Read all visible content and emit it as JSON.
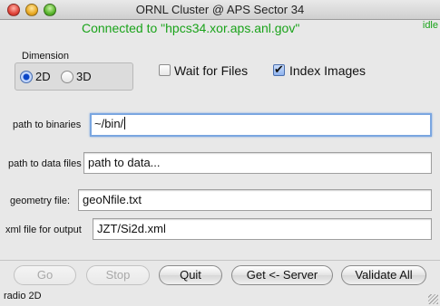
{
  "window": {
    "title": "ORNL Cluster @ APS Sector 34"
  },
  "status": {
    "connection": "Connected to \"hpcs34.xor.aps.anl.gov\"",
    "state": "idle",
    "footer": "radio 2D"
  },
  "dimension": {
    "label": "Dimension",
    "options": [
      "2D",
      "3D"
    ],
    "selected": "2D"
  },
  "options": {
    "wait_for_files": {
      "label": "Wait for Files",
      "checked": false
    },
    "index_images": {
      "label": "Index Images",
      "checked": true
    }
  },
  "fields": {
    "binaries": {
      "label": "path to binaries",
      "value": "~/bin/"
    },
    "data": {
      "label": "path to data files",
      "value": "path to data..."
    },
    "geometry": {
      "label": "geometry file:",
      "value": "geoNfile.txt"
    },
    "xml": {
      "label": "xml file for output",
      "value": "JZT/Si2d.xml"
    }
  },
  "buttons": {
    "go": "Go",
    "stop": "Stop",
    "quit": "Quit",
    "get_server": "Get <- Server",
    "validate": "Validate All"
  },
  "colors": {
    "connection_text": "#1aa31a",
    "focus_ring": "#7aa6e0"
  }
}
